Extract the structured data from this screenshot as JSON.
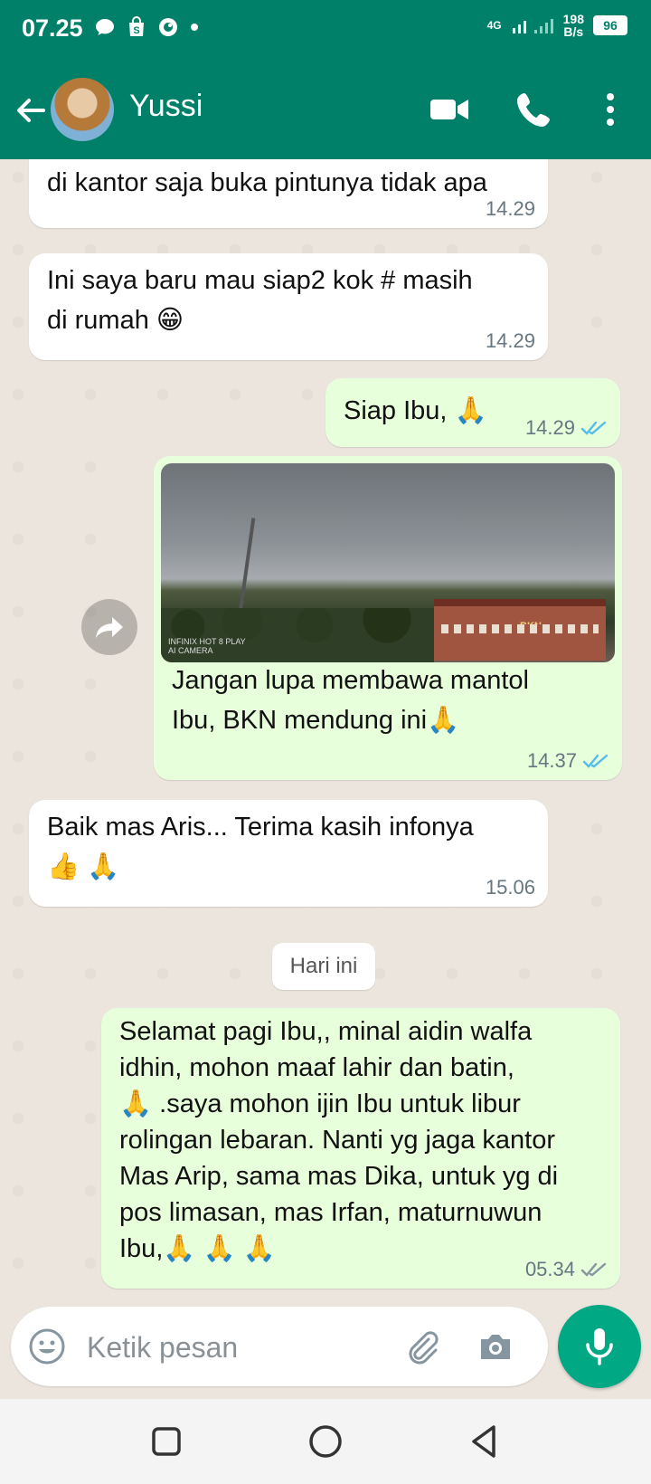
{
  "status_bar": {
    "time": "07.25",
    "network": "4G",
    "speed_value": "198",
    "speed_unit": "B/s",
    "battery": "96"
  },
  "header": {
    "contact_name": "Yussi"
  },
  "messages": [
    {
      "dir": "in",
      "text": "di kantor saja buka pintunya tidak apa",
      "time": "14.29"
    },
    {
      "dir": "in",
      "text": "Ini saya baru mau siap2 kok # masih\ndi rumah 😁",
      "time": "14.29"
    },
    {
      "dir": "out",
      "text": "Siap Ibu, 🙏",
      "time": "14.29",
      "status": "read"
    },
    {
      "dir": "out",
      "type": "image",
      "caption": "Jangan lupa membawa mantol\nIbu, BKN mendung ini🙏",
      "time": "14.37",
      "status": "read",
      "photo_text": {
        "building_sign": "BKN",
        "watermark_line1": "INFINIX HOT 8 PLAY",
        "watermark_line2": "AI CAMERA"
      }
    },
    {
      "dir": "in",
      "text": "Baik mas Aris... Terima kasih infonya\n👍 🙏",
      "time": "15.06"
    },
    {
      "dir": "out",
      "text": "Selamat pagi Ibu,, minal aidin walfa\nidhin, mohon maaf lahir dan batin,\n🙏 .saya mohon ijin Ibu untuk libur\nrolingan lebaran. Nanti yg jaga kantor\nMas Arip, sama mas Dika, untuk yg di\npos limasan, mas Irfan, maturnuwun\nIbu,🙏 🙏 🙏",
      "time": "05.34",
      "status": "delivered"
    }
  ],
  "date_divider": "Hari ini",
  "composer": {
    "placeholder": "Ketik pesan"
  },
  "icons": {
    "back": "arrow-left-icon",
    "video": "video-call-icon",
    "call": "phone-icon",
    "menu": "more-vertical-icon",
    "emoji": "emoji-icon",
    "attach": "paperclip-icon",
    "camera": "camera-icon",
    "mic": "microphone-icon",
    "forward": "forward-icon"
  },
  "colors": {
    "header": "#008069",
    "outgoing_bubble": "#E7FFDB",
    "incoming_bubble": "#FFFFFF",
    "read_tick": "#53BDEB",
    "mic_button": "#00A884",
    "chat_bg": "#ECE5DD"
  }
}
